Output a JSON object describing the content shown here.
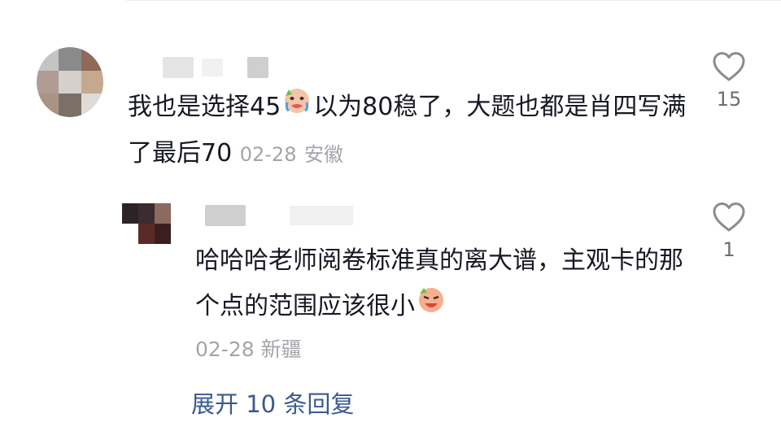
{
  "comments": [
    {
      "text_before_emoji": "我也是选择45",
      "text_after_emoji": "以为80稳了，大题也都是肖四写满了最后70",
      "emoji": "crying-face-emoji",
      "date": "02-28",
      "location": "安徽",
      "likes": "15",
      "avatar_colors": [
        "#c4c4c4",
        "#8a8a8a",
        "#8f6a58",
        "#b09b95",
        "#d5cfcd",
        "#c6a88e",
        "#a99384",
        "#7a7066",
        "#e0dbd8"
      ]
    },
    {
      "text": "哈哈哈老师阅卷标准真的离大谱，主观卡的那个点的范围应该很小",
      "emoji": "loudly-crying-emoji",
      "date": "02-28",
      "location": "新疆",
      "likes": "1",
      "avatar_colors": [
        "#2b2326",
        "#3c2b2e",
        "#8a6a61",
        "#ffffff",
        "#ffffff",
        "#5a2a26",
        "#3a1f21",
        "#ffffff"
      ]
    }
  ],
  "replies": {
    "expand_label": "展开 10 条回复"
  }
}
